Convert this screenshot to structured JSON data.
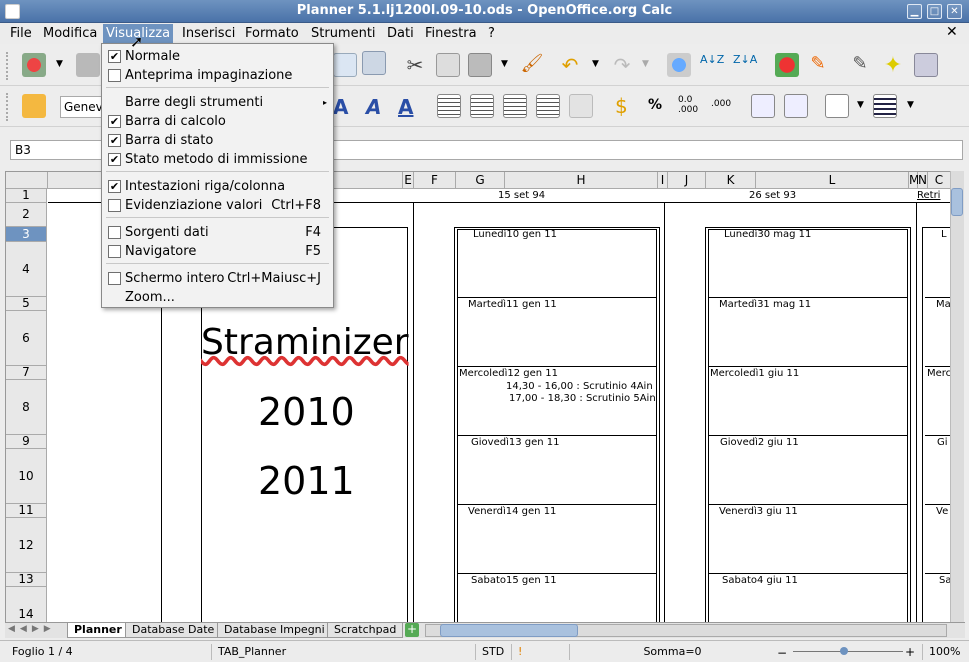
{
  "window": {
    "title": "Planner 5.1.lj1200l.09-10.ods - OpenOffice.org Calc"
  },
  "menubar": {
    "items": [
      "File",
      "Modifica",
      "Visualizza",
      "Inserisci",
      "Formato",
      "Strumenti",
      "Dati",
      "Finestra",
      "?"
    ]
  },
  "toolbar2": {
    "font_name": "Genev",
    "percent": "%",
    "decimal_add": "0.0\n.000",
    "decimal_del": ".000"
  },
  "namebox": {
    "value": "B3"
  },
  "view_menu": {
    "items": [
      {
        "label": "Normale",
        "checked": true
      },
      {
        "label": "Anteprima impaginazione",
        "checked": false
      },
      {
        "label": "Barre degli strumenti",
        "submenu": true
      },
      {
        "label": "Barra di calcolo",
        "checked": true
      },
      {
        "label": "Barra di stato",
        "checked": true
      },
      {
        "label": "Stato metodo di immissione",
        "checked": true
      },
      {
        "label": "Intestazioni riga/colonna",
        "checked": true
      },
      {
        "label": "Evidenziazione valori",
        "checked": false,
        "shortcut": "Ctrl+F8"
      },
      {
        "label": "Sorgenti dati",
        "checked": false,
        "shortcut": "F4"
      },
      {
        "label": "Navigatore",
        "checked": false,
        "shortcut": "F5"
      },
      {
        "label": "Schermo intero",
        "checked": false,
        "shortcut": "Ctrl+Maiusc+J"
      },
      {
        "label": "Zoom..."
      }
    ]
  },
  "columns": [
    "E",
    "F",
    "G",
    "H",
    "I",
    "J",
    "K",
    "L",
    "M",
    "N",
    "C"
  ],
  "rows": [
    "1",
    "2",
    "3",
    "4",
    "5",
    "6",
    "7",
    "8",
    "9",
    "10",
    "11",
    "12",
    "13",
    "14"
  ],
  "sheet": {
    "title_text": "Straminizer",
    "year1": "2010",
    "year2": "2011",
    "week1_header": "15 set 94",
    "week2_header": "26 set 93",
    "week3_header": "Retri",
    "week1_days": [
      "Lunedì10 gen 11",
      "Martedì11 gen 11",
      "Mercoledì12 gen 11",
      "Giovedì13 gen 11",
      "Venerdì14 gen 11",
      "Sabato15 gen 11"
    ],
    "week1_notes": [
      "14,30 - 16,00 : Scrutinio 4Ain",
      "17,00 - 18,30 : Scrutinio 5Ain"
    ],
    "week2_days": [
      "Lunedì30 mag 11",
      "Martedì31 mag 11",
      "Mercoledì1 giu 11",
      "Giovedì2 giu 11",
      "Venerdì3 giu 11",
      "Sabato4 giu 11"
    ],
    "week3_days": [
      "L",
      "Ma",
      "Merc",
      "Gi",
      "Ve",
      "Sa"
    ]
  },
  "tabs": [
    "Planner",
    "Database Date",
    "Database Impegni",
    "Scratchpad"
  ],
  "status": {
    "sheet": "Foglio 1 / 4",
    "style": "TAB_Planner",
    "mode": "STD",
    "sum": "Somma=0",
    "zoom": "100%"
  }
}
